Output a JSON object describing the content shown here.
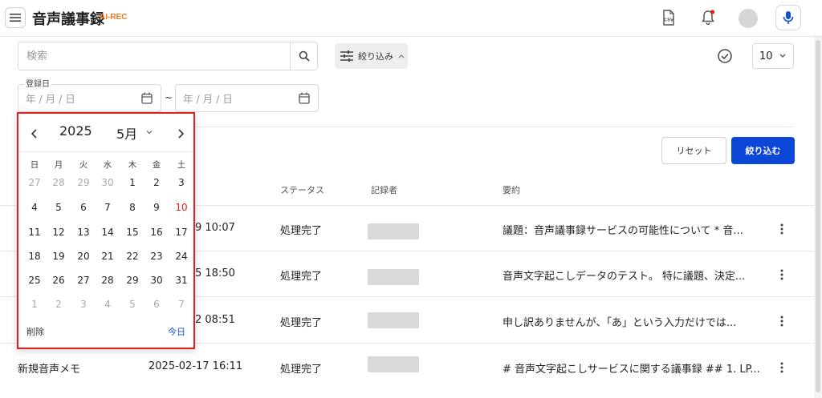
{
  "header": {
    "title": "音声議事録",
    "badge": "AI-REC",
    "csv_icon_label": "CSV"
  },
  "search": {
    "placeholder": "検索"
  },
  "filter": {
    "label": "絞り込み"
  },
  "per_page": {
    "value": "10"
  },
  "date_filter": {
    "label": "登録日",
    "from_placeholder": "年 / 月 / 日",
    "to_placeholder": "年 / 月 / 日",
    "separator": "~"
  },
  "actions": {
    "reset": "リセット",
    "apply": "絞り込む"
  },
  "table": {
    "columns": [
      "ステータス",
      "記録者",
      "要約"
    ],
    "rows": [
      {
        "date": "9 10:07",
        "status": "処理完了",
        "summary": "議題：音声議事録サービスの可能性について * 音..."
      },
      {
        "date": "5 18:50",
        "status": "処理完了",
        "summary": "音声文字起こしデータのテスト。 特に議題、決定..."
      },
      {
        "date": "2 08:51",
        "status": "処理完了",
        "summary": "申し訳ありませんが、「あ」という入力だけでは..."
      },
      {
        "title": "新規音声メモ",
        "date": "2025-02-17 16:11",
        "status": "処理完了",
        "summary": "# 音声文字起こしサービスに関する議事録 ## 1. LP..."
      }
    ]
  },
  "calendar": {
    "year": "2025",
    "month": "5月",
    "weekdays": [
      "日",
      "月",
      "火",
      "水",
      "木",
      "金",
      "土"
    ],
    "weeks": [
      [
        {
          "d": "27",
          "m": true
        },
        {
          "d": "28",
          "m": true
        },
        {
          "d": "29",
          "m": true
        },
        {
          "d": "30",
          "m": true
        },
        {
          "d": "1"
        },
        {
          "d": "2"
        },
        {
          "d": "3"
        }
      ],
      [
        {
          "d": "4"
        },
        {
          "d": "5"
        },
        {
          "d": "6"
        },
        {
          "d": "7"
        },
        {
          "d": "8"
        },
        {
          "d": "9"
        },
        {
          "d": "10",
          "r": true
        }
      ],
      [
        {
          "d": "11"
        },
        {
          "d": "12"
        },
        {
          "d": "13"
        },
        {
          "d": "14"
        },
        {
          "d": "15"
        },
        {
          "d": "16"
        },
        {
          "d": "17"
        }
      ],
      [
        {
          "d": "18"
        },
        {
          "d": "19"
        },
        {
          "d": "20"
        },
        {
          "d": "21"
        },
        {
          "d": "22"
        },
        {
          "d": "23"
        },
        {
          "d": "24"
        }
      ],
      [
        {
          "d": "25"
        },
        {
          "d": "26"
        },
        {
          "d": "27"
        },
        {
          "d": "28"
        },
        {
          "d": "29"
        },
        {
          "d": "30"
        },
        {
          "d": "31"
        }
      ],
      [
        {
          "d": "1",
          "m": true
        },
        {
          "d": "2",
          "m": true
        },
        {
          "d": "3",
          "m": true
        },
        {
          "d": "4",
          "m": true
        },
        {
          "d": "5",
          "m": true
        },
        {
          "d": "6",
          "m": true
        },
        {
          "d": "7",
          "m": true
        }
      ]
    ],
    "clear_label": "削除",
    "today_label": "今日"
  },
  "colors": {
    "accent": "#0c47d8",
    "brand_orange": "#f0781e",
    "highlight_red": "#e02020",
    "today_blue": "#1150d6"
  }
}
